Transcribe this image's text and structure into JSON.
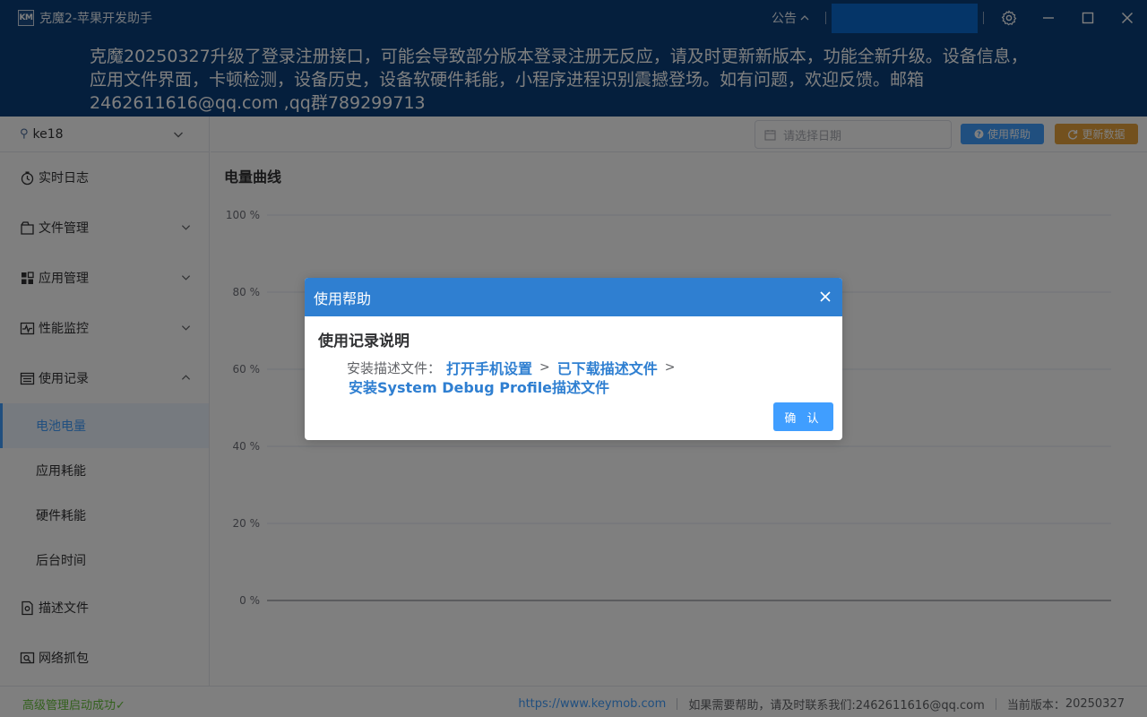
{
  "app": {
    "logo_text": "KM",
    "title": "克魔2-苹果开发助手",
    "notice_label": "公告"
  },
  "banner": {
    "text": "克魔20250327升级了登录注册接口，可能会导致部分版本登录注册无反应，请及时更新新版本，功能全新升级。设备信息，应用文件界面，卡顿检测，设备历史，设备软硬件耗能，小程序进程识别震撼登场。如有问题，欢迎反馈。邮箱2462611616@qq.com ,qq群789299713"
  },
  "sidebar": {
    "device_name": "ke18",
    "menu": [
      {
        "label": "实时日志",
        "icon": "realtime-log-icon"
      },
      {
        "label": "文件管理",
        "icon": "file-manage-icon"
      },
      {
        "label": "应用管理",
        "icon": "app-manage-icon"
      },
      {
        "label": "性能监控",
        "icon": "performance-icon"
      },
      {
        "label": "使用记录",
        "icon": "usage-record-icon"
      }
    ],
    "submenu": [
      {
        "label": "电池电量",
        "active": true
      },
      {
        "label": "应用耗能",
        "active": false
      },
      {
        "label": "硬件耗能",
        "active": false
      },
      {
        "label": "后台时间",
        "active": false
      }
    ],
    "menu_bottom": [
      {
        "label": "描述文件",
        "icon": "profile-icon"
      },
      {
        "label": "网络抓包",
        "icon": "network-capture-icon"
      }
    ]
  },
  "toolbar": {
    "date_placeholder": "请选择日期",
    "help_label": "使用帮助",
    "update_label": "更新数据"
  },
  "chart_data": {
    "type": "line",
    "title": "电量曲线",
    "y_ticks": [
      "100 %",
      "80 %",
      "60 %",
      "40 %",
      "20 %",
      "0 %"
    ],
    "ylim": [
      0,
      100
    ],
    "series": []
  },
  "status": {
    "left": "高级管理启动成功",
    "website": "https://www.keymob.com",
    "contact": "如果需要帮助，请及时联系我们:2462611616@qq.com",
    "version_label": "当前版本：",
    "version": "20250327"
  },
  "dialog": {
    "title": "使用帮助",
    "subtitle": "使用记录说明",
    "prefix": "安装描述文件：",
    "step1": "打开手机设置",
    "sep": ">",
    "step2": "已下载描述文件",
    "step3": "安装System Debug Profile描述文件",
    "confirm": "确 认"
  },
  "colors": {
    "titlebar": "#0a3f7b",
    "primary": "#409eff",
    "warning": "#e6a23c",
    "success": "#67c23a",
    "dialog_header": "#2f7fd1"
  }
}
